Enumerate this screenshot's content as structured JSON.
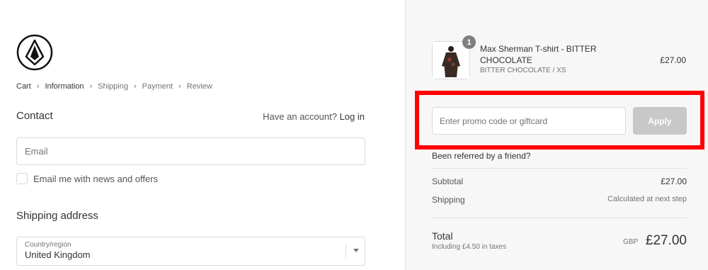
{
  "breadcrumb": {
    "items": [
      "Cart",
      "Information",
      "Shipping",
      "Payment",
      "Review"
    ]
  },
  "contact": {
    "title": "Contact",
    "have_account": "Have an account?",
    "login_link": "Log in",
    "email_placeholder": "Email",
    "newsletter_label": "Email me with news and offers",
    "newsletter_checked": false
  },
  "shipping": {
    "title": "Shipping address",
    "country_label": "Country/region",
    "country_value": "United Kingdom"
  },
  "cart": {
    "item": {
      "name": "Max Sherman T-shirt - BITTER CHOCOLATE",
      "variant": "BITTER CHOCOLATE / XS",
      "price": "£27.00",
      "quantity": "1"
    },
    "promo_placeholder": "Enter promo code or giftcard",
    "apply_label": "Apply",
    "referred_text": "Been referred by a friend?",
    "subtotal_label": "Subtotal",
    "subtotal_value": "£27.00",
    "shipping_label": "Shipping",
    "shipping_value": "Calculated at next step",
    "total_label": "Total",
    "tax_note": "Including £4.50 in taxes",
    "currency": "GBP",
    "total_value": "£27.00"
  },
  "colors": {
    "highlight": "#ff0000",
    "apply_disabled": "#c8c8c8"
  }
}
